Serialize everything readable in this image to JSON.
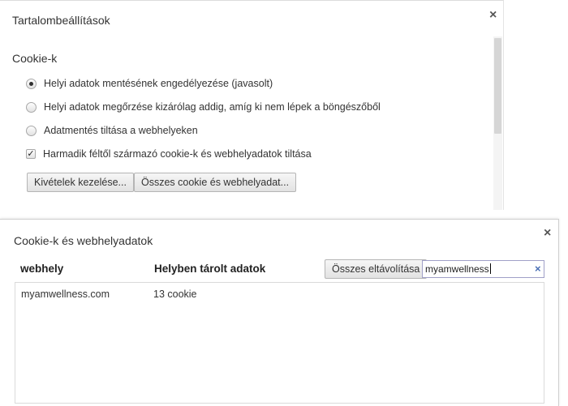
{
  "content_settings": {
    "title": "Tartalombeállítások",
    "close_label": "×",
    "cookies_heading": "Cookie-k",
    "options": [
      {
        "label": "Helyi adatok mentésének engedélyezése (javasolt)",
        "checked": true
      },
      {
        "label": "Helyi adatok megőrzése kizárólag addig, amíg ki nem lépek a böngészőből",
        "checked": false
      },
      {
        "label": "Adatmentés tiltása a webhelyeken",
        "checked": false
      }
    ],
    "third_party": {
      "label": "Harmadik féltől származó cookie-k és webhelyadatok tiltása",
      "checked": true
    },
    "manage_exceptions_label": "Kivételek kezelése...",
    "all_cookies_label": "Összes cookie és webhelyadat..."
  },
  "cookies_dialog": {
    "title": "Cookie-k és webhelyadatok",
    "close_label": "×",
    "col_site": "webhely",
    "col_local_data": "Helyben tárolt adatok",
    "remove_all_label": "Összes eltávolítása",
    "search_value": "myamwellness",
    "clear_label": "×",
    "rows": [
      {
        "site": "myamwellness.com",
        "data": "13 cookie"
      }
    ]
  },
  "colors": {
    "accent_clear": "#4a6fb5",
    "text": "#333333"
  }
}
